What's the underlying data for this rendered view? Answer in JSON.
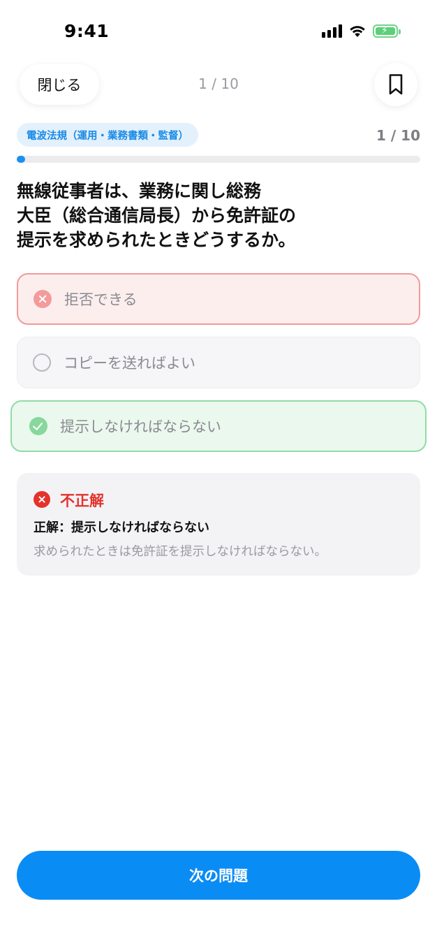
{
  "status_bar": {
    "time": "9:41",
    "icons": [
      "signal-icon",
      "wifi-icon",
      "battery-charging-icon"
    ]
  },
  "header": {
    "close_label": "閉じる",
    "counter": "1 / 10",
    "bookmark_icon": "bookmark-icon"
  },
  "quiz": {
    "category": "電波法規（運用・業務書類・監督）",
    "counter": "1 / 10",
    "progress": 0.02,
    "question_lines": [
      "無線従事者は、業務に関し総務",
      "大臣（総合通信局長）から免許証の",
      "提示を求められたときどうするか。"
    ],
    "options": [
      {
        "label": "拒否できる",
        "state": "selected-wrong",
        "icon": "x-circle-icon"
      },
      {
        "label": "コピーを送ればよい",
        "state": "unselected",
        "icon": "radio-empty-icon"
      },
      {
        "label": "提示しなければならない",
        "state": "correct",
        "icon": "check-circle-icon"
      }
    ]
  },
  "feedback": {
    "title": "不正解",
    "answer": "正解：提示しなければならない",
    "explanation": "求められたときは免許証を提示しなければならない。"
  },
  "footer": {
    "next_label": "次の問題"
  },
  "colors": {
    "primary": "#0a8cf5",
    "wrong": "#e5322d",
    "wrong_border": "#f19a9a",
    "correct_border": "#8fdca4",
    "category_bg": "#e3f1fd",
    "category_text": "#1a8ae5"
  }
}
